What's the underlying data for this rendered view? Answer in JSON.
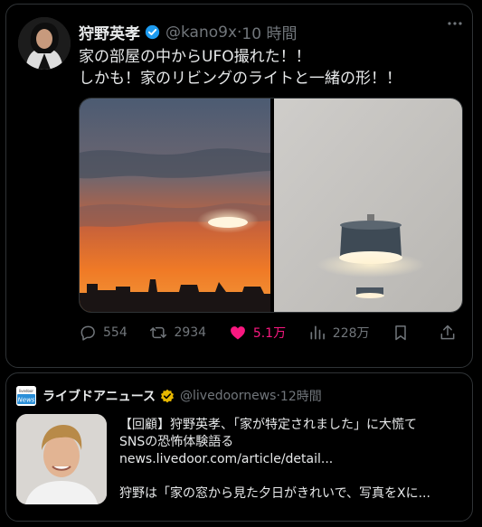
{
  "tweet": {
    "name": "狩野英孝",
    "handle": "@kano9x",
    "separator": "·",
    "time": "10 時間",
    "text": "家の部屋の中からUFO撮れた！！\nしかも！家のリビングのライトと一緒の形！！",
    "actions": {
      "replies": "554",
      "retweets": "2934",
      "likes": "5.1万",
      "views": "228万"
    },
    "icons": [
      "verified-badge-icon",
      "more-icon",
      "reply-icon",
      "retweet-icon",
      "like-icon",
      "views-icon",
      "bookmark-icon",
      "share-icon"
    ],
    "colors": {
      "like": "#f91880",
      "muted": "#71767b",
      "verified": "#1d9bf0"
    }
  },
  "quote": {
    "logo_text": "livedoor\nNews",
    "name": "ライブドアニュース",
    "handle": "@livedoornews",
    "separator": "·",
    "time": "12時間",
    "line1": "【回顧】狩野英孝、「家が特定されました」に大慌て",
    "line2": "SNSの恐怖体験語る",
    "link": "news.livedoor.com/article/detail...",
    "line4": "狩野は「家の窓から見た夕日がきれいで、写真をXに...",
    "colors": {
      "verified": "#e8b800"
    }
  }
}
